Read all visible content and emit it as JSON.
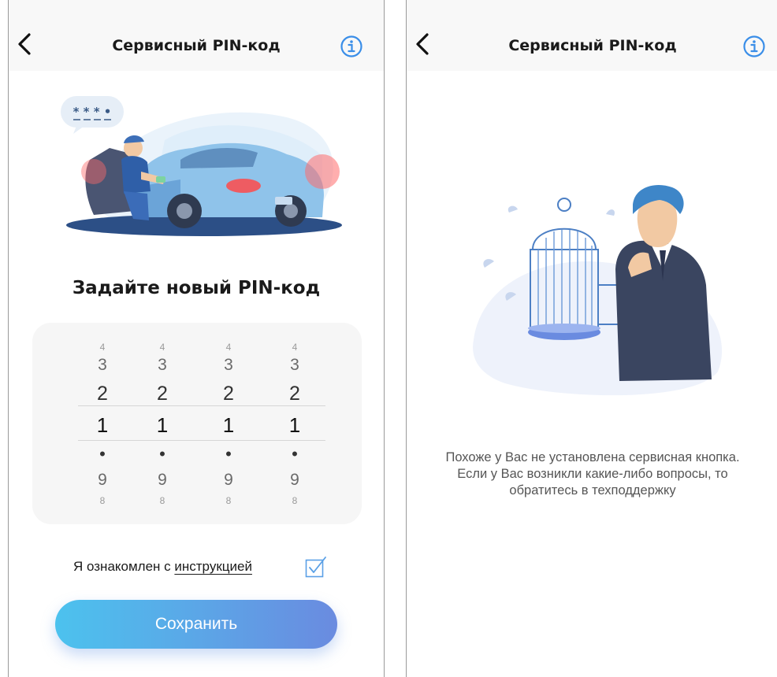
{
  "left_screen": {
    "title": "Сервисный PIN-код",
    "heading": "Задайте новый PIN-код",
    "pin_picker": {
      "columns": [
        {
          "r4": "4",
          "r3": "3",
          "r2": "2",
          "selected": "1",
          "r0": "•",
          "r9": "9",
          "r8": "8"
        },
        {
          "r4": "4",
          "r3": "3",
          "r2": "2",
          "selected": "1",
          "r0": "•",
          "r9": "9",
          "r8": "8"
        },
        {
          "r4": "4",
          "r3": "3",
          "r2": "2",
          "selected": "1",
          "r0": "•",
          "r9": "9",
          "r8": "8"
        },
        {
          "r4": "4",
          "r3": "3",
          "r2": "2",
          "selected": "1",
          "r0": "•",
          "r9": "9",
          "r8": "8"
        }
      ]
    },
    "agreement": {
      "text": "Я ознакомлен с ",
      "link": "инструкцией",
      "checked": true
    },
    "save_label": "Сохранить",
    "speech_bubble": "* * * •"
  },
  "right_screen": {
    "title": "Сервисный PIN-код",
    "message": "Похоже у Вас не установлена сервисная кнопка. Если у Вас возникли какие-либо вопросы, то обратитесь в техподдержку"
  },
  "icons": {
    "back": "chevron-left-icon",
    "info": "info-circle-icon",
    "checkbox": "checkbox-checked-icon"
  },
  "colors": {
    "accent_blue": "#3a8ee8",
    "button_gradient_start": "#4cc2ee",
    "button_gradient_end": "#6a8be0",
    "checkbox": "#5aa0e6"
  }
}
